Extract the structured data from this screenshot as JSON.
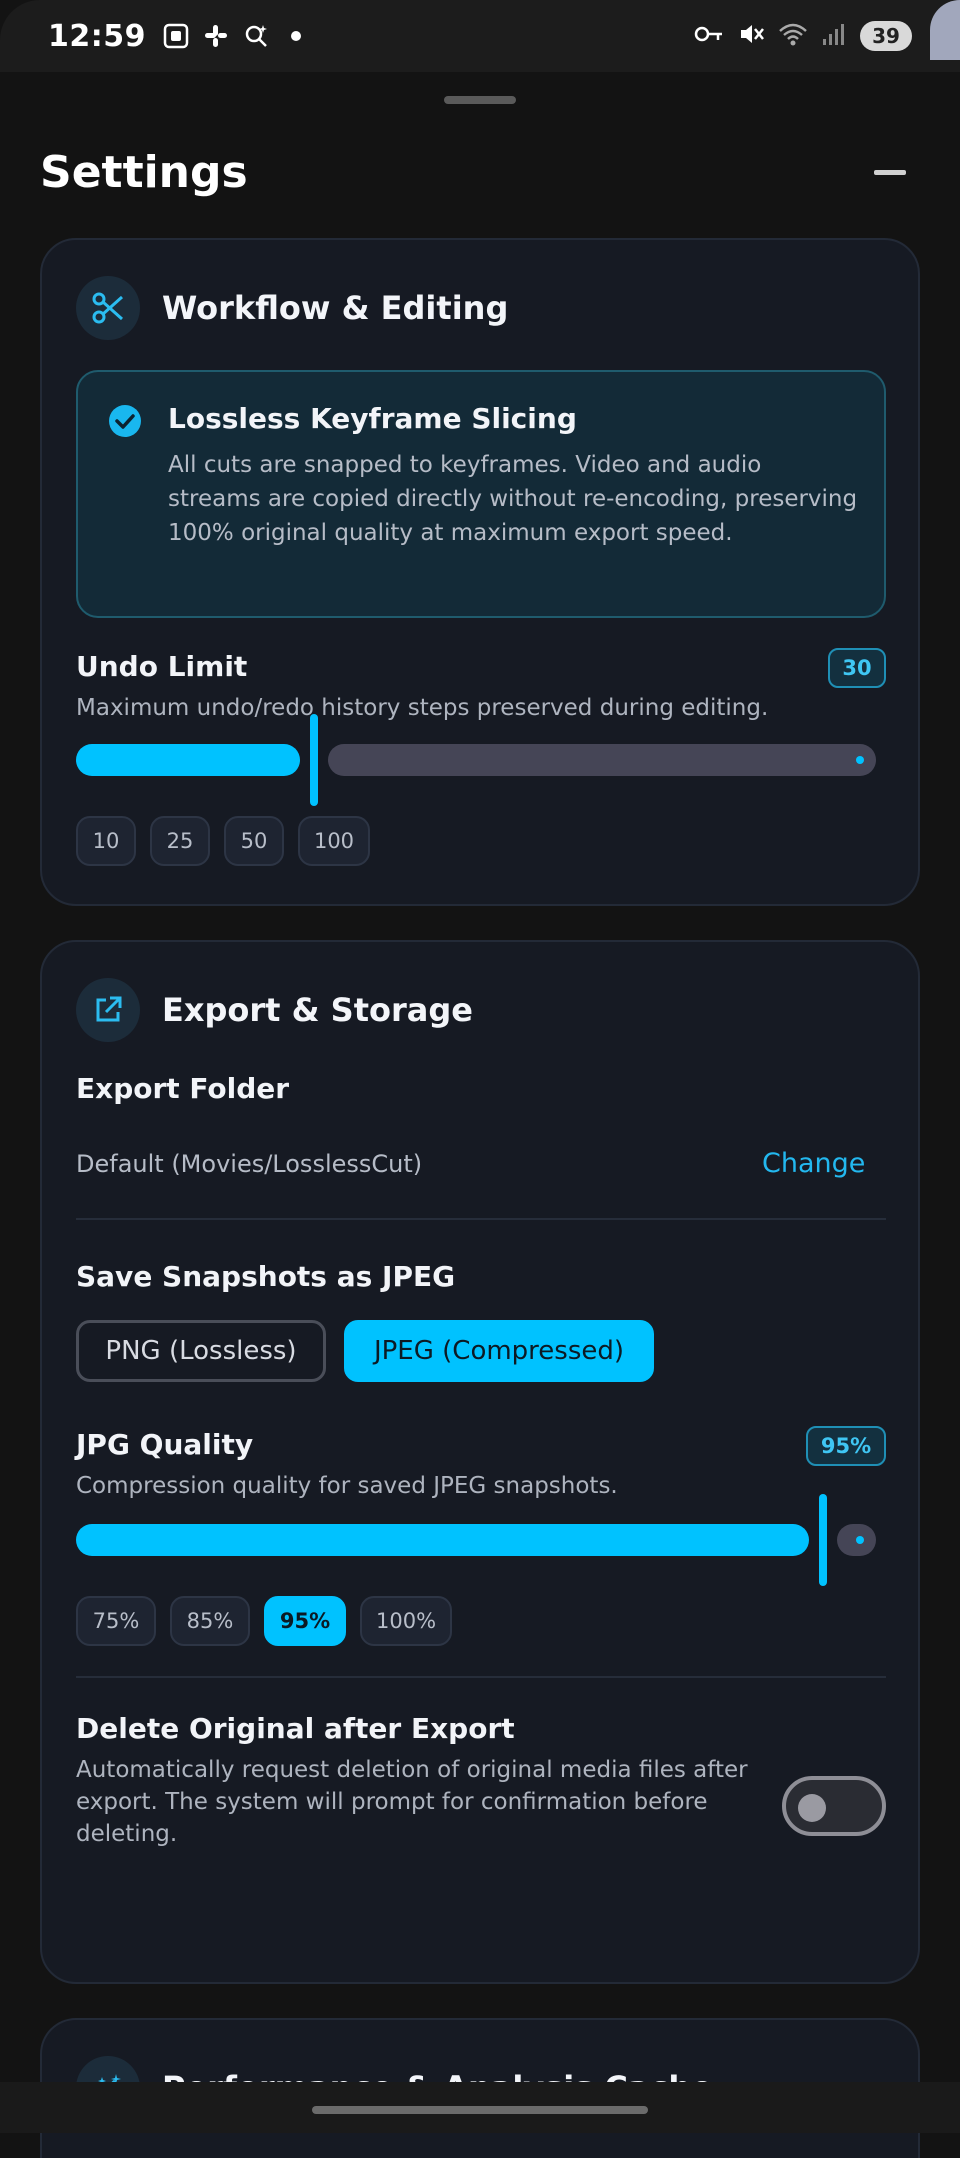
{
  "status_bar": {
    "time": "12:59",
    "battery": "39",
    "icons_left": [
      "screenshot-icon",
      "slack-icon",
      "search-sparkle-icon",
      "dot-icon"
    ],
    "icons_right": [
      "key-icon",
      "mute-icon",
      "wifi-icon",
      "signal-icon"
    ]
  },
  "header": {
    "title": "Settings"
  },
  "workflow": {
    "title": "Workflow & Editing",
    "icon": "scissors-icon",
    "info_title": "Lossless Keyframe Slicing",
    "info_text": "All cuts are snapped to keyframes. Video and audio streams are copied directly without re-encoding, preserving 100% original quality at maximum export speed.",
    "undo": {
      "label": "Undo Limit",
      "value": "30",
      "desc": "Maximum undo/redo history steps preserved during editing.",
      "fraction": 0.29,
      "presets": [
        "10",
        "25",
        "50",
        "100"
      ]
    }
  },
  "export": {
    "title": "Export & Storage",
    "icon": "external-link-icon",
    "folder_label": "Export Folder",
    "folder_value": "Default (Movies/LosslessCut)",
    "change_label": "Change",
    "snapshot_label": "Save Snapshots as JPEG",
    "formats": [
      "PNG (Lossless)",
      "JPEG (Compressed)"
    ],
    "selected_format": "JPEG (Compressed)",
    "quality": {
      "label": "JPG Quality",
      "value": "95%",
      "desc": "Compression quality for saved JPEG snapshots.",
      "fraction": 0.95,
      "presets": [
        "75%",
        "85%",
        "95%",
        "100%"
      ],
      "selected": "95%"
    },
    "delete_label": "Delete Original after Export",
    "delete_desc": "Automatically request deletion of original media files after export. The system will prompt for confirmation before deleting.",
    "delete_enabled": false
  },
  "performance": {
    "title": "Performance & Analysis Cache",
    "icon": "magic-wand-icon"
  },
  "colors": {
    "accent": "#00c2ff",
    "card_bg": "#161a23",
    "page_bg": "#131313"
  }
}
